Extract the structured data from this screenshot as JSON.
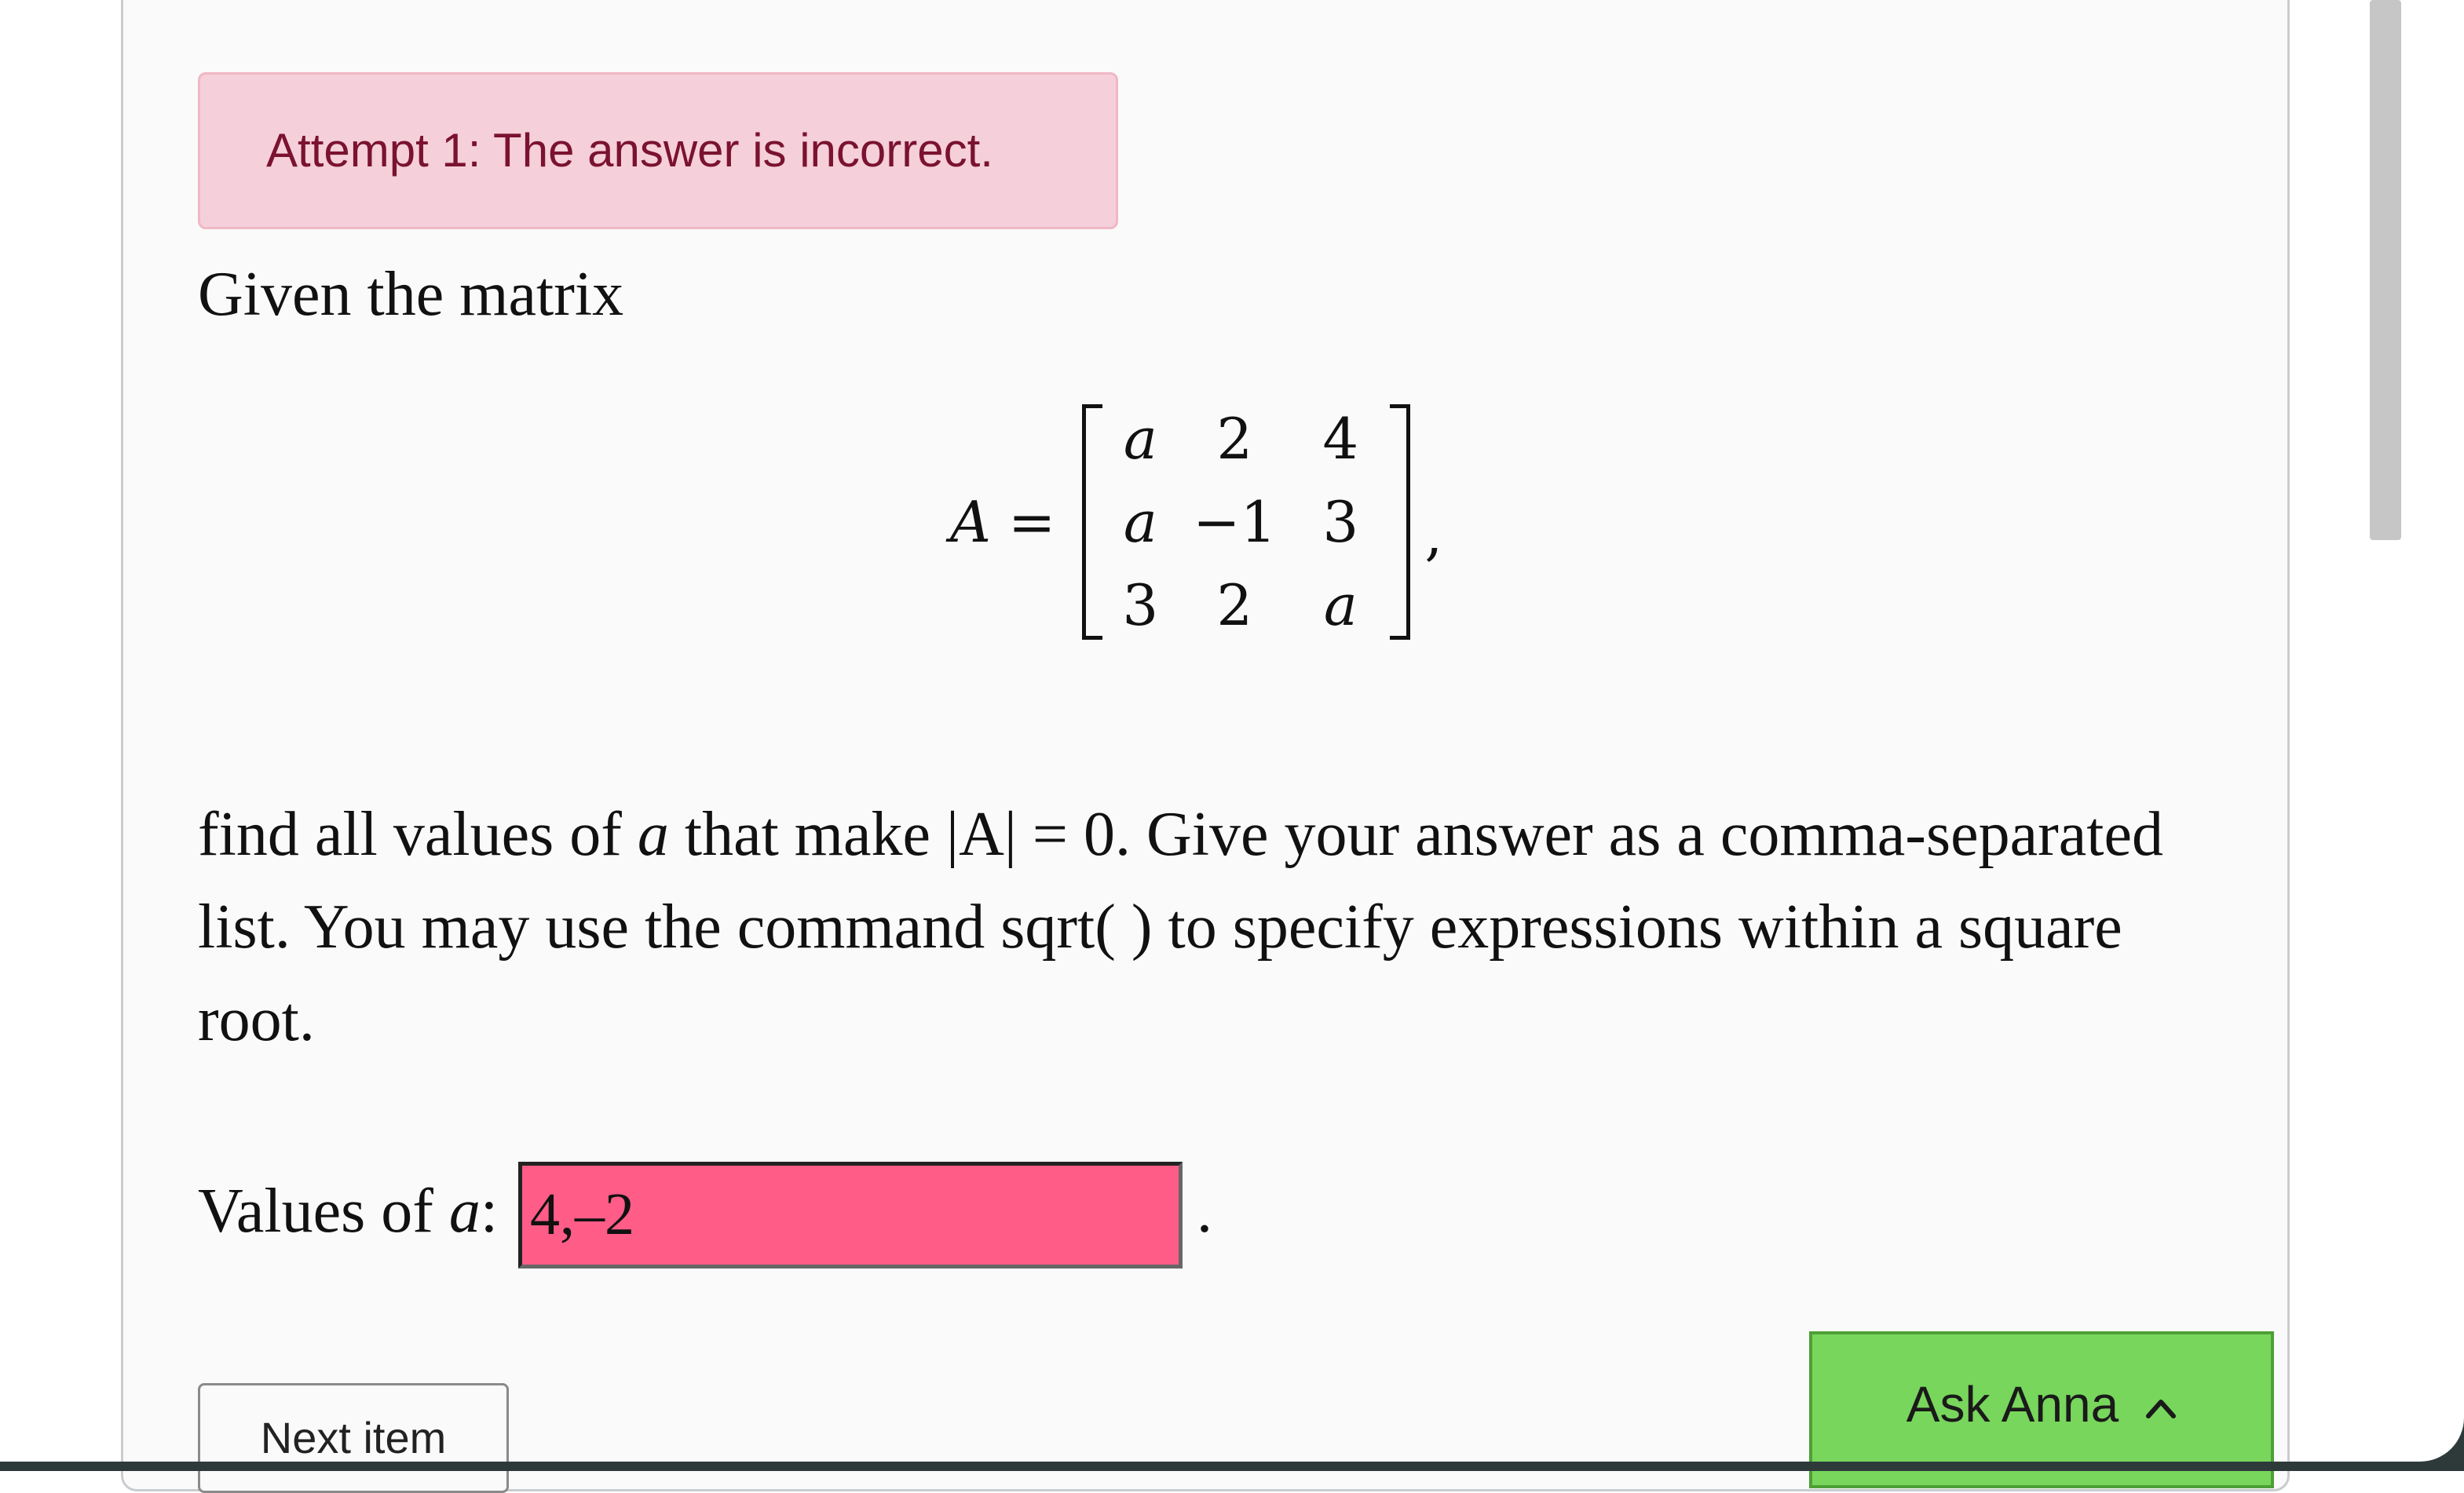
{
  "feedback": {
    "message": "Attempt 1: The answer is incorrect."
  },
  "question": {
    "intro": "Given the matrix",
    "matrix_name": "A",
    "equals": "=",
    "matrix": [
      [
        "a",
        "2",
        "4"
      ],
      [
        "a",
        "−1",
        "3"
      ],
      [
        "3",
        "2",
        "a"
      ]
    ],
    "trailing": ",",
    "prompt_part1": "find all values of ",
    "prompt_var": "a",
    "prompt_part2": " that make ",
    "det_expr": "|A| = 0",
    "prompt_part3": ". Give your answer as a comma-separated list. You may use the command sqrt( ) to specify expressions within a square root."
  },
  "answer": {
    "label_prefix": "Values of ",
    "label_var": "a",
    "label_suffix": ":",
    "value": "4,–2",
    "status": "incorrect",
    "trailing": "."
  },
  "buttons": {
    "next_item": "Next item",
    "ask_anna": "Ask Anna"
  },
  "icons": {
    "ask_anna_chevron": "chevron-up-icon"
  },
  "colors": {
    "alert_bg": "#f5cfda",
    "alert_text": "#7a1230",
    "incorrect_input_bg": "#ff5c88",
    "ask_anna_bg": "#78d65c"
  }
}
